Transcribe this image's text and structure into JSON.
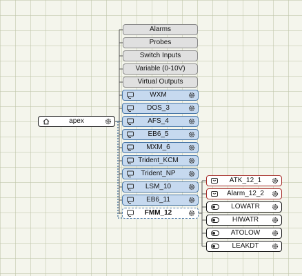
{
  "root": {
    "label": "apex",
    "icon": "home-icon"
  },
  "categories": [
    "Alarms",
    "Probes",
    "Switch Inputs",
    "Variable (0-10V)",
    "Virtual Outputs"
  ],
  "modules": [
    "WXM",
    "DOS_3",
    "AFS_4",
    "EB6_5",
    "MXM_6",
    "Trident_KCM",
    "Trident_NP",
    "LSM_10",
    "EB6_11",
    "FMM_12"
  ],
  "selected_module": "FMM_12",
  "alarms": [
    "ATK_12_1",
    "Alarm_12_2"
  ],
  "inputs": [
    "LOWATR",
    "HIWATR",
    "ATOLOW",
    "LEAKDT"
  ],
  "colors": {
    "module_fill": "#c6d9ef",
    "module_border": "#4a78a7",
    "alarm_border": "#a7302c",
    "input_border": "#1c1c1c",
    "category_fill": "#e0e0e0"
  }
}
